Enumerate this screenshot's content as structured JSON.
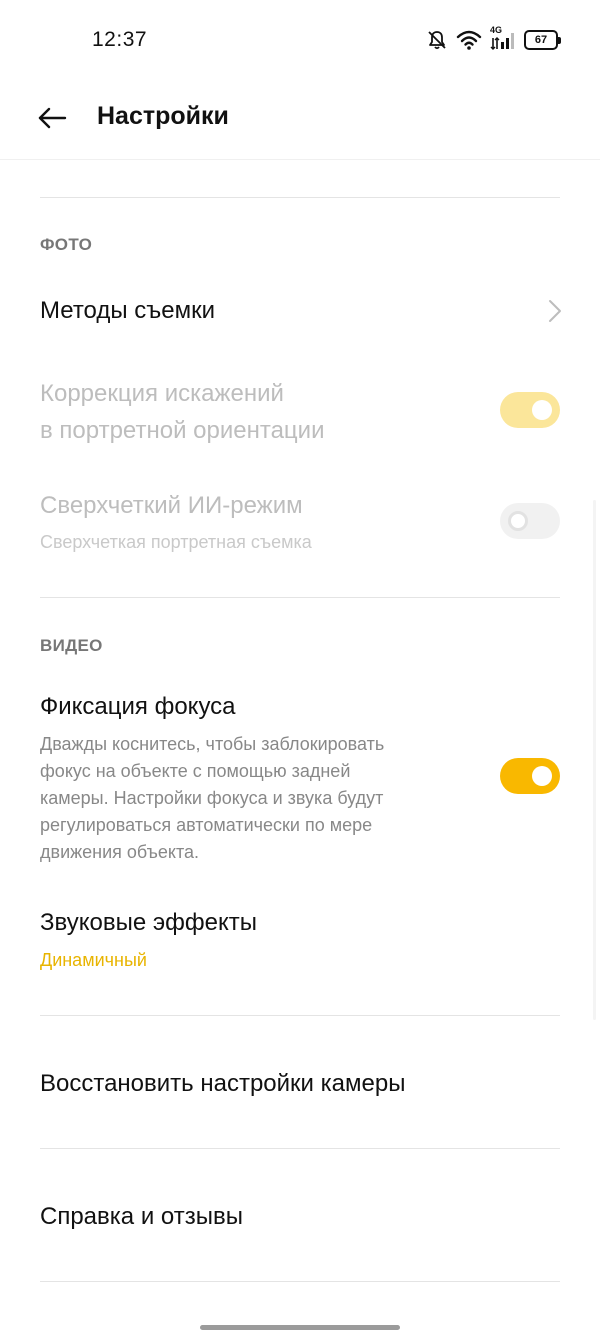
{
  "status_bar": {
    "time": "12:37",
    "network": "4G",
    "battery": "67",
    "icons": [
      "bell-off-icon",
      "wifi-icon",
      "signal-icon",
      "battery-icon"
    ]
  },
  "app_bar": {
    "back_icon": "arrow-left-icon",
    "title": "Настройки"
  },
  "sections": {
    "photo": {
      "header": "ФОТО",
      "shooting_methods": {
        "title": "Методы съемки"
      },
      "distortion_correction": {
        "title_line1": "Коррекция искажений",
        "title_line2": "в портретной ориентации",
        "toggle": "on",
        "enabled": false
      },
      "ultra_clear": {
        "title": "Сверхчеткий ИИ-режим",
        "subtitle": "Сверхчеткая портретная съемка",
        "toggle": "off",
        "enabled": false
      }
    },
    "video": {
      "header": "ВИДЕО",
      "focus_lock": {
        "title": "Фиксация фокуса",
        "desc_lines": [
          "Дважды коснитесь, чтобы заблокировать",
          "фокус на объекте с помощью задней",
          "камеры. Настройки фокуса и звука будут",
          "регулироваться автоматически по мере",
          "движения объекта."
        ],
        "toggle": "on"
      },
      "sound_effects": {
        "title": "Звуковые эффекты",
        "value": "Динамичный"
      }
    }
  },
  "restore": {
    "title": "Восстановить настройки камеры"
  },
  "help": {
    "title": "Справка и отзывы"
  },
  "colors": {
    "accent": "#f9b800",
    "accent_text": "#e8b400",
    "disabled_text": "#bdbdbd"
  }
}
